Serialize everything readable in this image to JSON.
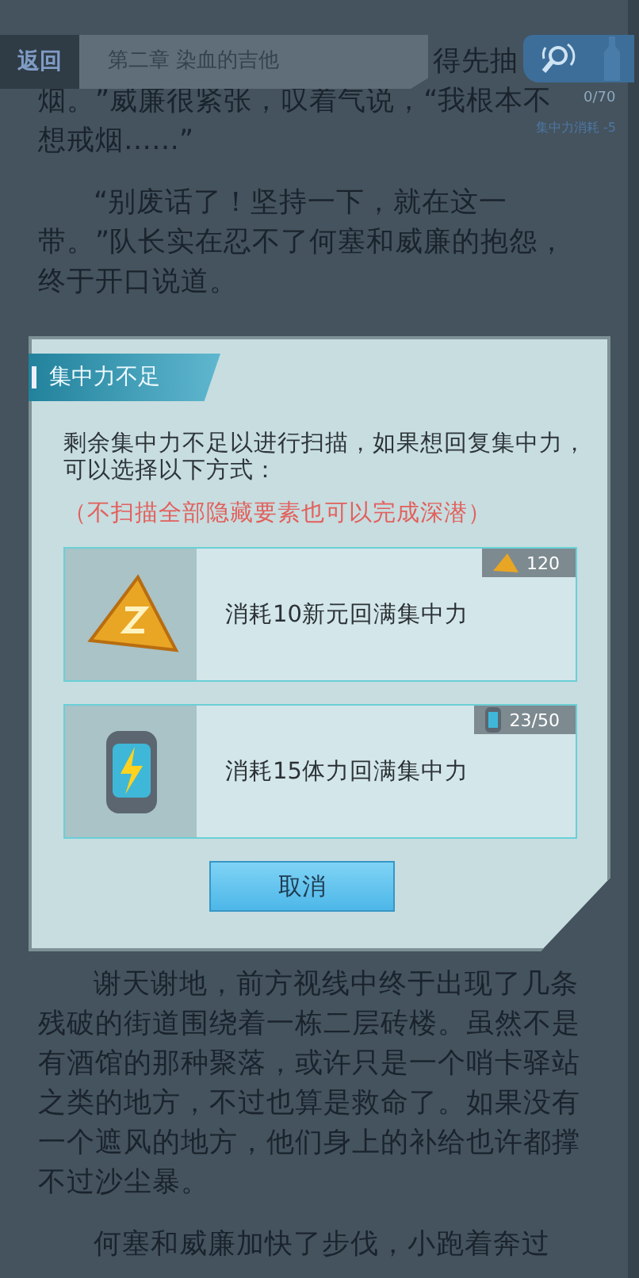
{
  "header": {
    "back_label": "返回",
    "chapter_title": "第二章  染血的吉他"
  },
  "focus_meter": {
    "count": "0/70",
    "cost": "集中力消耗 -5"
  },
  "story": {
    "fragment": "得先抽",
    "paragraphs_top": [
      {
        "indent": false,
        "lines": [
          "烟。”威廉很紧张，叹着气说，“我根本不",
          "想戒烟……”"
        ]
      },
      {
        "indent": true,
        "lines": [
          "“别废话了！坚持一下，就在这一",
          "带。”队长实在忍不了何塞和威廉的抱怨，",
          "终于开口说道。"
        ]
      }
    ],
    "paragraphs_bottom": [
      {
        "indent": true,
        "lines": [
          "谢天谢地，前方视线中终于出现了几条",
          "残破的街道围绕着一栋二层砖楼。虽然不是",
          "有酒馆的那种聚落，或许只是一个哨卡驿站",
          "之类的地方，不过也算是救命了。如果没有",
          "一个遮风的地方，他们身上的补给也许都撑",
          "不过沙尘暴。"
        ]
      },
      {
        "indent": true,
        "lines": [
          "何塞和威廉加快了步伐，小跑着奔过"
        ]
      }
    ]
  },
  "dialog": {
    "title": "集中力不足",
    "message": "剩余集中力不足以进行扫描，如果想回复集中力，可以选择以下方式：",
    "note": "（不扫描全部隐藏要素也可以完成深潜）",
    "options": [
      {
        "kind": "coin",
        "label": "消耗10新元回满集中力",
        "balance": "120"
      },
      {
        "kind": "battery",
        "label": "消耗15体力回满集中力",
        "balance": "23/50"
      }
    ],
    "cancel_label": "取消"
  }
}
